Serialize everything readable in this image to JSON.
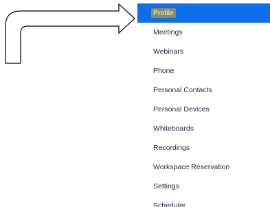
{
  "colors": {
    "active_background": "#0e6eeb",
    "active_text": "#ffffff",
    "label_highlight": "#8a8f5e",
    "item_text": "#1f2937"
  },
  "annotation": {
    "icon": "bent-arrow-right-icon"
  },
  "menu": {
    "active_index": 0,
    "items": [
      {
        "label": "Profile"
      },
      {
        "label": "Meetings"
      },
      {
        "label": "Webinars"
      },
      {
        "label": "Phone"
      },
      {
        "label": "Personal Contacts"
      },
      {
        "label": "Personal Devices"
      },
      {
        "label": "Whiteboards"
      },
      {
        "label": "Recordings"
      },
      {
        "label": "Workspace Reservation"
      },
      {
        "label": "Settings"
      },
      {
        "label": "Scheduler"
      }
    ]
  }
}
